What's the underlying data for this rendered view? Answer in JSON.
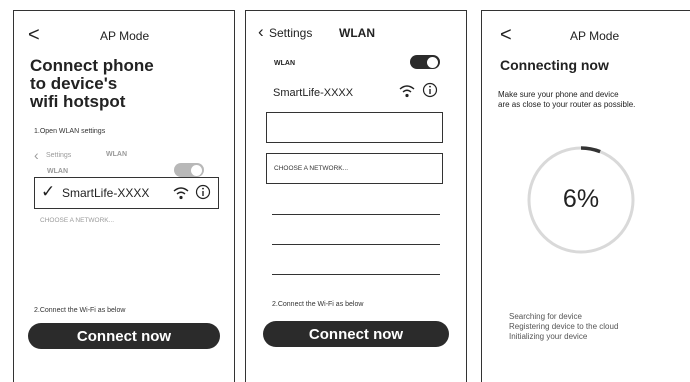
{
  "panel1": {
    "back_icon": "<",
    "title": "AP Mode",
    "heading": [
      "Connect phone",
      "to device's",
      "wifi hotspot"
    ],
    "step1": "1.Open WLAN settings",
    "mini": {
      "back": "Settings",
      "title": "WLAN",
      "wlan_label": "WLAN",
      "network": "SmartLife-XXXX",
      "choose": "CHOOSE A NETWORK..."
    },
    "step2": "2.Connect the Wi-Fi as below",
    "button": "Connect now"
  },
  "panel2": {
    "back": "Settings",
    "title": "WLAN",
    "wlan_label": "WLAN",
    "network": "SmartLife-XXXX",
    "choose": "CHOOSE A NETWORK...",
    "step2": "2.Connect the Wi-Fi as below",
    "button": "Connect now"
  },
  "panel3": {
    "back_icon": "<",
    "title": "AP Mode",
    "heading": "Connecting now",
    "desc": [
      "Make sure your phone and device",
      "are as close to your router as possible."
    ],
    "progress_value": 0.06,
    "progress_text": "6%",
    "steps": [
      "Searching for device",
      "Registering device to the cloud",
      "Initializing your device"
    ]
  },
  "colors": {
    "button": "#2b2b2b",
    "toggle_on": "#2b2b2b",
    "toggle_off": "#b8b8b8",
    "ring": "#d9d9d9",
    "ring_progress": "#333333"
  }
}
